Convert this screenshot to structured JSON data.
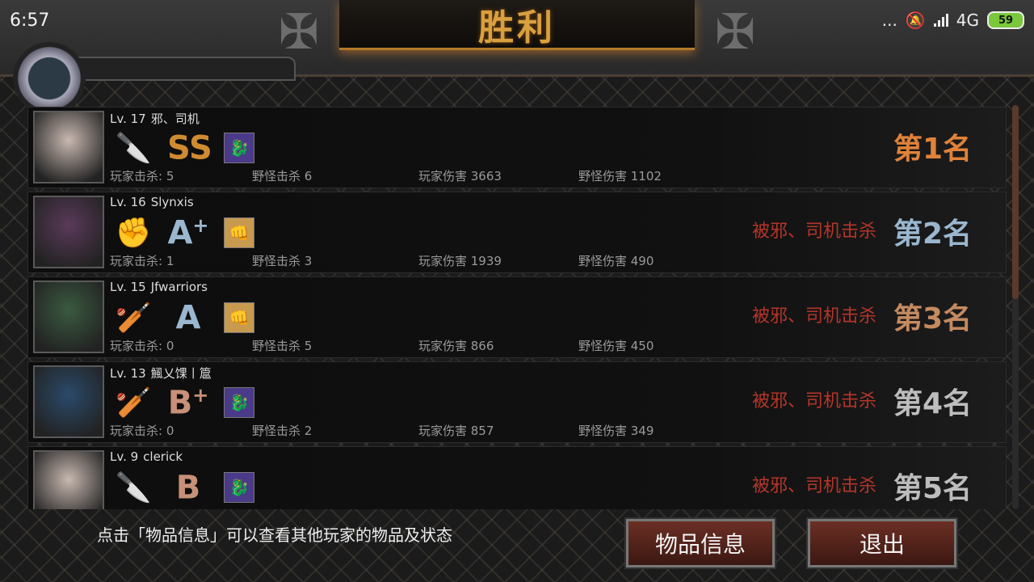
{
  "status_bar": {
    "time": "6:57",
    "dots": "...",
    "network": "4G",
    "battery": "59"
  },
  "header": {
    "title": "胜利"
  },
  "players": [
    {
      "level": "Lv. 17",
      "name": "邪、司机",
      "weapon_icon": "knife-icon",
      "grade": "SS",
      "grade_plus": "",
      "grade_color": "#d08a30",
      "skill_icon": "dragon-skill-icon",
      "skill_color": "#4b3a8a",
      "portrait_color": "#c8b8b0",
      "killed_by": "",
      "rank": "第1名",
      "rank_class": "rank-1",
      "stats": {
        "player_kills": "玩家击杀: 5",
        "monster_kills": "野怪击杀 6",
        "player_damage": "玩家伤害 3663",
        "monster_damage": "野怪伤害 1102"
      }
    },
    {
      "level": "Lv. 16",
      "name": "Slynxis",
      "weapon_icon": "fist-icon",
      "grade": "A",
      "grade_plus": "+",
      "grade_color": "#9ab7cf",
      "skill_icon": "fist-skill-icon",
      "skill_color": "#c89a50",
      "portrait_color": "#5a3a5a",
      "killed_by": "被邪、司机击杀",
      "rank": "第2名",
      "rank_class": "rank-2",
      "stats": {
        "player_kills": "玩家击杀: 1",
        "monster_kills": "野怪击杀 3",
        "player_damage": "玩家伤害 1939",
        "monster_damage": "野怪伤害 490"
      }
    },
    {
      "level": "Lv. 15",
      "name": "Jfwarriors",
      "weapon_icon": "bat-icon",
      "grade": "A",
      "grade_plus": "",
      "grade_color": "#9ab7cf",
      "skill_icon": "fist-skill-icon",
      "skill_color": "#c89a50",
      "portrait_color": "#3a5a40",
      "killed_by": "被邪、司机击杀",
      "rank": "第3名",
      "rank_class": "rank-3",
      "stats": {
        "player_kills": "玩家击杀: 0",
        "monster_kills": "野怪击杀 5",
        "player_damage": "玩家伤害 866",
        "monster_damage": "野怪伤害 450"
      }
    },
    {
      "level": "Lv. 13",
      "name": "鯴乂馃丨簄",
      "weapon_icon": "bat-icon",
      "grade": "B",
      "grade_plus": "+",
      "grade_color": "#c89078",
      "skill_icon": "dragon-skill-icon",
      "skill_color": "#4b3a8a",
      "portrait_color": "#2a4a6a",
      "killed_by": "被邪、司机击杀",
      "rank": "第4名",
      "rank_class": "rank-4",
      "stats": {
        "player_kills": "玩家击杀: 0",
        "monster_kills": "野怪击杀 2",
        "player_damage": "玩家伤害 857",
        "monster_damage": "野怪伤害 349"
      }
    },
    {
      "level": "Lv. 9",
      "name": "clerick",
      "weapon_icon": "knife-icon",
      "grade": "B",
      "grade_plus": "",
      "grade_color": "#c89078",
      "skill_icon": "dragon-skill-icon",
      "skill_color": "#4b3a8a",
      "portrait_color": "#c8b8b0",
      "killed_by": "被邪、司机击杀",
      "rank": "第5名",
      "rank_class": "rank-5",
      "stats": {
        "player_kills": "",
        "monster_kills": "",
        "player_damage": "",
        "monster_damage": ""
      }
    }
  ],
  "footer": {
    "hint": "点击「物品信息」可以查看其他玩家的物品及状态",
    "items_button": "物品信息",
    "exit_button": "退出"
  }
}
